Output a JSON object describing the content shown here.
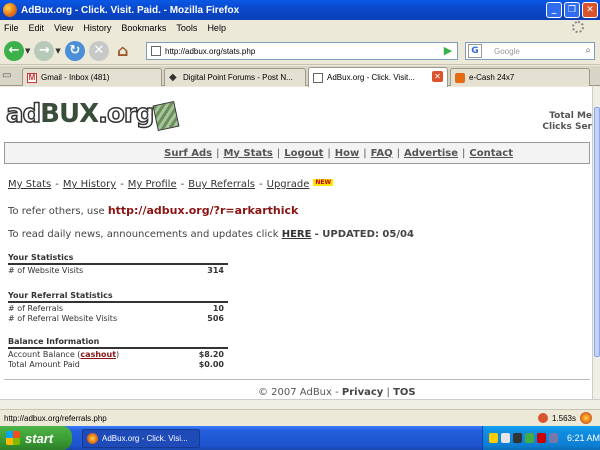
{
  "window": {
    "title": "AdBux.org - Click. Visit. Paid. - Mozilla Firefox"
  },
  "menu": [
    "File",
    "Edit",
    "View",
    "History",
    "Bookmarks",
    "Tools",
    "Help"
  ],
  "toolbar": {
    "url": "http://adbux.org/stats.php",
    "search_placeholder": "Google"
  },
  "tabs": [
    {
      "label": "Gmail - Inbox (481)",
      "active": false
    },
    {
      "label": "Digital Point Forums - Post N...",
      "active": false
    },
    {
      "label": "AdBux.org - Click. Visit...",
      "active": true
    },
    {
      "label": "e-Cash 24x7",
      "active": false
    }
  ],
  "page": {
    "logo": {
      "ad": "ad",
      "bux": "BUX",
      "org": ".org"
    },
    "topright": [
      "Total Me",
      "Clicks Ser"
    ],
    "main_nav": [
      "Surf Ads",
      "My Stats",
      "Logout",
      "How",
      "FAQ",
      "Advertise",
      "Contact"
    ],
    "sub_nav": [
      "My Stats",
      "My History",
      "My Profile",
      "Buy Referrals",
      "Upgrade"
    ],
    "new_badge": "NEW",
    "refer_text": "To refer others, use",
    "refer_link": "http://adbux.org/?r=arkarthick",
    "news_text": "To read daily news, announcements and updates click",
    "news_link": "HERE",
    "news_updated": "- UPDATED: 05/04",
    "your_stats": {
      "heading": "Your Statistics",
      "rows": [
        {
          "label": "# of Website Visits",
          "value": "314"
        }
      ]
    },
    "referral_stats": {
      "heading": "Your Referral Statistics",
      "rows": [
        {
          "label": "# of Referrals",
          "value": "10"
        },
        {
          "label": "# of Referral Website Visits",
          "value": "506"
        }
      ]
    },
    "balance": {
      "heading": "Balance Information",
      "account_label_pre": "Account Balance (",
      "cashout": "cashout",
      "account_label_post": ")",
      "account_value": "$8.20",
      "total_label": "Total Amount Paid",
      "total_value": "$0.00"
    },
    "footer": {
      "copyright": "© 2007 AdBux -",
      "privacy": "Privacy",
      "sep": "|",
      "tos": "TOS"
    }
  },
  "status": {
    "text": "http://adbux.org/referrals.php",
    "timing": "1.563s"
  },
  "taskbar": {
    "start": "start",
    "item": "AdBux.org - Click. Visi...",
    "clock": "6:21 AM"
  }
}
